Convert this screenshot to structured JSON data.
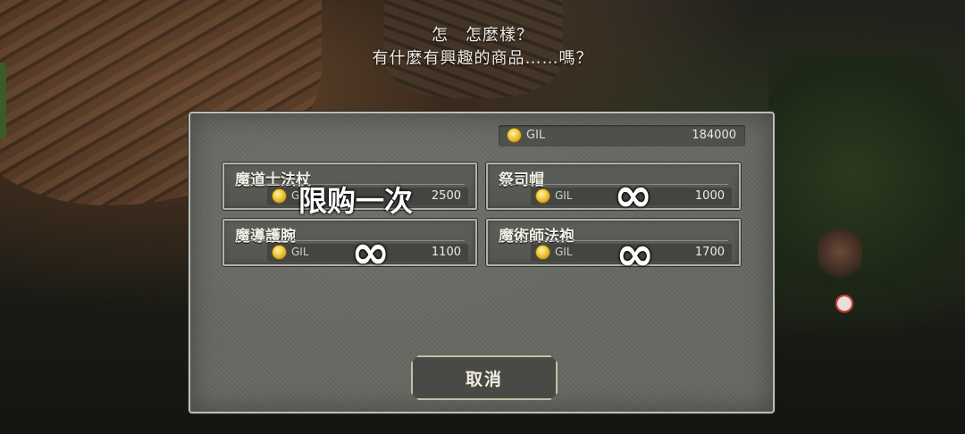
{
  "dialog": {
    "line1": "怎　怎麼樣？",
    "line2": "有什麼有興趣的商品……嗎？"
  },
  "wallet": {
    "currency_label": "GIL",
    "amount": "184000",
    "coin_icon": "gil-coin-icon"
  },
  "shop_items": [
    {
      "name": "魔道士法杖",
      "currency": "GIL",
      "price": "2500"
    },
    {
      "name": "祭司帽",
      "currency": "GIL",
      "price": "1000"
    },
    {
      "name": "魔導護腕",
      "currency": "GIL",
      "price": "1100"
    },
    {
      "name": "魔術師法袍",
      "currency": "GIL",
      "price": "1700"
    }
  ],
  "annotations": {
    "limit_once": "限购一次",
    "infinite": "∞"
  },
  "buttons": {
    "cancel": "取消"
  },
  "colors": {
    "panel": "#676963",
    "coin": "#f0c83a",
    "border": "#bdbdb6"
  }
}
